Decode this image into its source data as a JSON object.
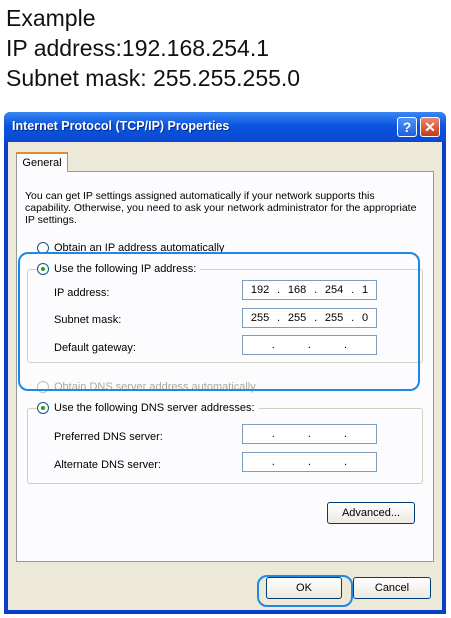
{
  "caption": {
    "line1": "Example",
    "line2": "IP address:192.168.254.1",
    "line3": "Subnet mask: 255.255.255.0"
  },
  "window": {
    "title": "Internet Protocol (TCP/IP) Properties",
    "help_label": "?",
    "close_label": "✕",
    "tab_general": "General",
    "intro": "You can get IP settings assigned automatically if your network supports this capability. Otherwise, you need to ask your network administrator for the appropriate IP settings.",
    "ip": {
      "radio_auto": "Obtain an IP address automatically",
      "radio_manual": "Use the following IP address:",
      "selected": "manual",
      "ip_label": "IP address:",
      "ip_value": [
        "192",
        "168",
        "254",
        "1"
      ],
      "mask_label": "Subnet mask:",
      "mask_value": [
        "255",
        "255",
        "255",
        "0"
      ],
      "gateway_label": "Default gateway:",
      "gateway_value": [
        "",
        "",
        "",
        ""
      ]
    },
    "dns": {
      "radio_auto": "Obtain DNS server address automatically",
      "radio_manual": "Use the following DNS server addresses:",
      "selected": "manual",
      "preferred_label": "Preferred DNS server:",
      "preferred_value": [
        "",
        "",
        "",
        ""
      ],
      "alternate_label": "Alternate DNS server:",
      "alternate_value": [
        "",
        "",
        "",
        ""
      ]
    },
    "advanced_label": "Advanced...",
    "ok_label": "OK",
    "cancel_label": "Cancel"
  },
  "colors": {
    "title_bar": "#0a55e0",
    "highlight": "#1e88e5",
    "dialog_bg": "#ece9d8"
  }
}
